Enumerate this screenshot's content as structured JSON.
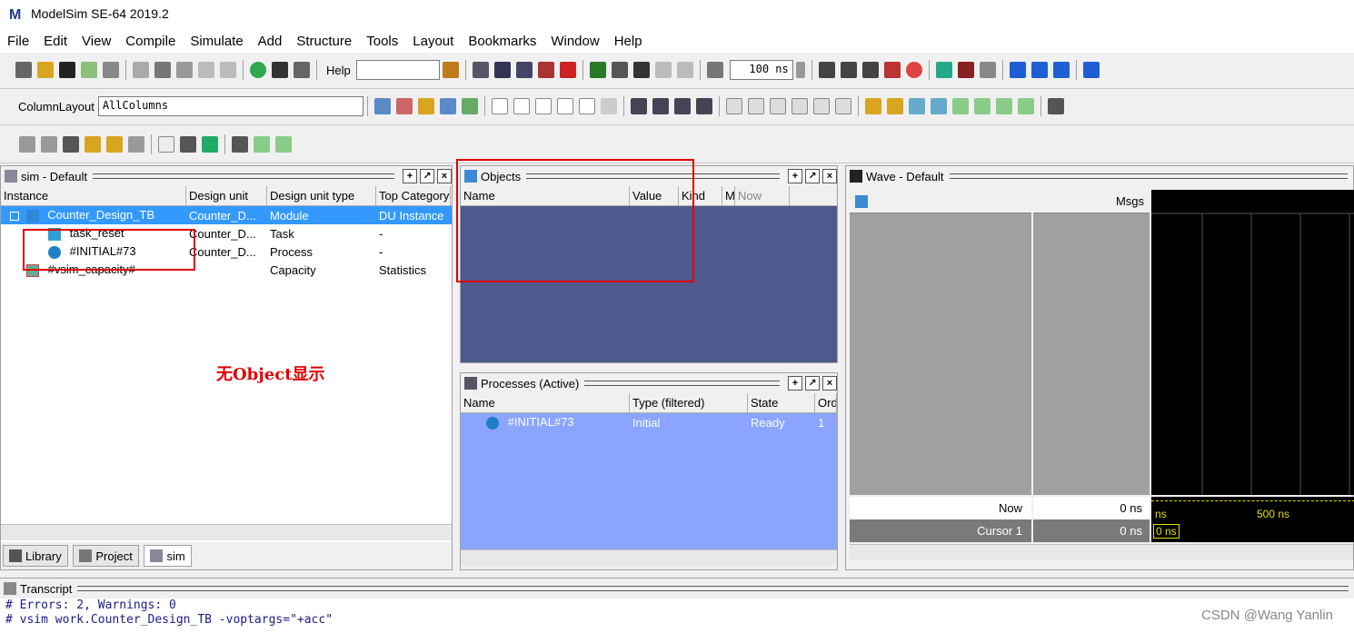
{
  "app": {
    "title": "ModelSim SE-64 2019.2",
    "logo": "M"
  },
  "menu": [
    "File",
    "Edit",
    "View",
    "Compile",
    "Simulate",
    "Add",
    "Structure",
    "Tools",
    "Layout",
    "Bookmarks",
    "Window",
    "Help"
  ],
  "toolbar": {
    "help_label": "Help",
    "run_length": "100 ns",
    "column_layout_label": "ColumnLayout",
    "column_layout_value": "AllColumns"
  },
  "sim_panel": {
    "title": "sim - Default",
    "columns": [
      "Instance",
      "Design unit",
      "Design unit type",
      "Top Category"
    ],
    "rows": [
      {
        "instance": "Counter_Design_TB",
        "unit": "Counter_D...",
        "type": "Module",
        "cat": "DU Instance"
      },
      {
        "instance": "task_reset",
        "unit": "Counter_D...",
        "type": "Task",
        "cat": "-"
      },
      {
        "instance": "#INITIAL#73",
        "unit": "Counter_D...",
        "type": "Process",
        "cat": "-"
      },
      {
        "instance": "#vsim_capacity#",
        "unit": "",
        "type": "Capacity",
        "cat": "Statistics"
      }
    ],
    "annotation": "无Object显示",
    "tabs": [
      "Library",
      "Project",
      "sim"
    ]
  },
  "objects_panel": {
    "title": "Objects",
    "columns": [
      "Name",
      "Value",
      "Kind",
      "M"
    ],
    "now_label": "Now"
  },
  "processes_panel": {
    "title": "Processes (Active)",
    "columns": [
      "Name",
      "Type (filtered)",
      "State",
      "Ord"
    ],
    "rows": [
      {
        "name": "#INITIAL#73",
        "type": "Initial",
        "state": "Ready",
        "order": "1"
      }
    ]
  },
  "wave_panel": {
    "title": "Wave - Default",
    "msgs_label": "Msgs",
    "now_label": "Now",
    "now_value": "0 ns",
    "cursor_label": "Cursor 1",
    "cursor_value": "0 ns",
    "time_start": "ns",
    "time_mark": "500 ns",
    "cursor_time": "0 ns"
  },
  "transcript": {
    "title": "Transcript",
    "lines": [
      "# Errors: 2, Warnings: 0",
      "# vsim work.Counter_Design_TB -voptargs=\"+acc\""
    ]
  },
  "watermark": "CSDN @Wang Yanlin",
  "colors": {
    "objects_bg": "#4e5a8e",
    "process_bg": "#8aa4ff",
    "select": "#3399ff",
    "wave_bg": "#000000",
    "annotation_red": "#e00000"
  }
}
